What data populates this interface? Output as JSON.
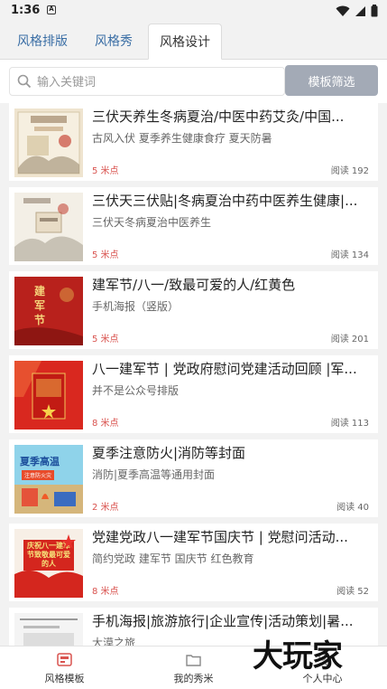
{
  "status": {
    "time": "1:36",
    "notif": "A"
  },
  "tabs": [
    "风格排版",
    "风格秀",
    "风格设计"
  ],
  "search": {
    "placeholder": "输入关键词",
    "button": "模板筛选"
  },
  "cards": [
    {
      "title": "三伏天养生冬病夏治/中医中药艾灸/中国...",
      "subtitle": "古风入伏 夏季养生健康食疗 夏天防暑",
      "points": "5 米点",
      "reads": "阅读 192"
    },
    {
      "title": "三伏天三伏贴|冬病夏治中药中医养生健康|...",
      "subtitle": "三伏天冬病夏治中医养生",
      "points": "5 米点",
      "reads": "阅读 134"
    },
    {
      "title": "建军节/八一/致最可爱的人/红黄色",
      "subtitle": "手机海报（竖版）",
      "points": "5 米点",
      "reads": "阅读 201"
    },
    {
      "title": "八一建军节 | 党政府慰问党建活动回顾 |军...",
      "subtitle": "并不是公众号排版",
      "points": "8 米点",
      "reads": "阅读 113"
    },
    {
      "title": "夏季注意防火|消防等封面",
      "subtitle": "消防|夏季高温等通用封面",
      "points": "2 米点",
      "reads": "阅读 40"
    },
    {
      "title": "党建党政八一建军节国庆节 | 党慰问活动...",
      "subtitle": "简约党政 建军节 国庆节 红色教育",
      "points": "8 米点",
      "reads": "阅读 52"
    },
    {
      "title": "手机海报|旅游旅行|企业宣传|活动策划|暑...",
      "subtitle": "大漠之旅",
      "points": "",
      "reads": ""
    }
  ],
  "thumb_text": {
    "t3": "建军节",
    "t5": "夏季高温",
    "t5b": "注意防火灾",
    "t6": "庆祝八一建军节致敬最可爱的人"
  },
  "nav": [
    "风格模板",
    "我的秀米",
    "个人中心"
  ],
  "watermark": "大玩家",
  "colors": {
    "accent": "#3a6ea5",
    "points": "#d9534f",
    "button": "#a3aab6"
  }
}
